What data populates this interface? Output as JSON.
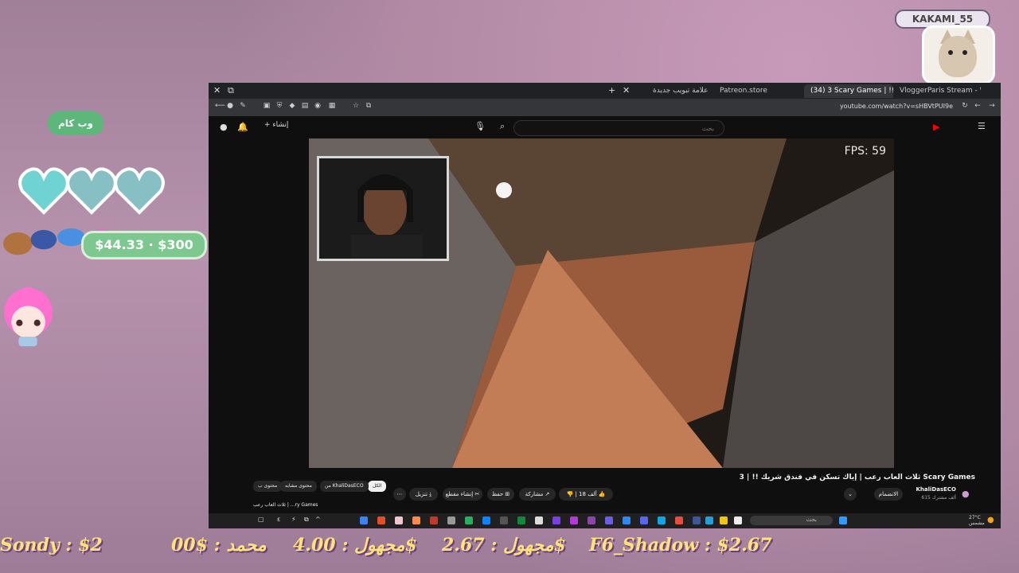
{
  "overlay": {
    "viewer_name": "KAKAMI_55",
    "webcam_label": "وب كام",
    "goal_text": "$44.33 · $300",
    "donors": [
      "Sondy : $2",
      "00$ : محمد",
      "مجهول : 4.00$",
      "مجهول : 2.67$",
      "F6_Shadow : $2.67"
    ]
  },
  "browser": {
    "tabs": [
      {
        "label": "VloggerParis Stream - Watch L",
        "active": false
      },
      {
        "label": "(34) 3 Scary Games | !!",
        "active": true
      },
      {
        "label": "Patreon.store",
        "active": false
      },
      {
        "label": "علامة تبويب جديدة",
        "active": false
      }
    ],
    "url": "youtube.com/watch?v=sHBVtPUI9e"
  },
  "youtube": {
    "search_placeholder": "بحث",
    "create_label": "+ إنشاء",
    "fps_label": "FPS: 59",
    "video_title": "ثلاث العاب رعب | إياك تسكن في فندق شريك !! | 3 Scary Games",
    "channel_name": "KhaliDasECO",
    "subscriber_text": "615 ألف مشترك",
    "join_label": "الانضمام",
    "like_count": "18 ألف",
    "share_label": "مشاركة",
    "save_label": "حفظ",
    "clip_label": "إنشاء مقطع",
    "download_label": "تنزيل",
    "chips": [
      {
        "label": "الكل",
        "active": true
      },
      {
        "label": "من KhaliDasECO",
        "active": false
      },
      {
        "label": "محتوى مشابه",
        "active": false
      },
      {
        "label": "محتوى ب",
        "active": false
      }
    ],
    "related_title": "ثلاث العاب رعب | ...ry Games"
  },
  "taskbar": {
    "search_placeholder": "بحث",
    "temp": "27°C",
    "weather_sub": "مشمس"
  }
}
